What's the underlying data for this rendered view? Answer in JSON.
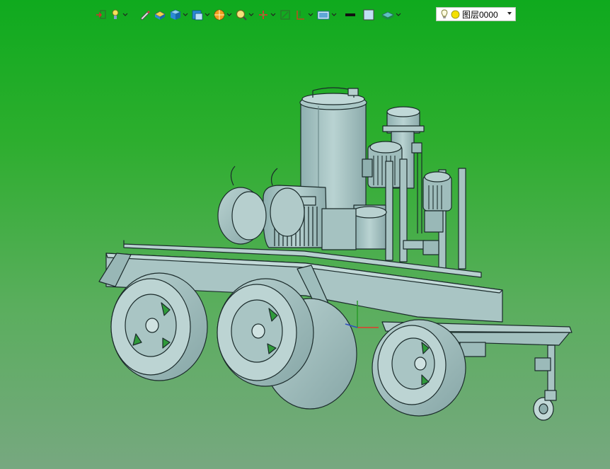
{
  "toolbar": {
    "buttons": [
      {
        "icon": "view-orient-icon",
        "has_menu": true
      },
      {
        "icon": "view-light-icon",
        "has_menu": true
      },
      {
        "icon": "pencil-sketch-icon",
        "has_menu": false
      },
      {
        "icon": "shaded-solid-icon",
        "has_menu": false
      },
      {
        "icon": "cube-view-icon",
        "has_menu": true
      },
      {
        "icon": "display-mode-icon",
        "has_menu": true
      },
      {
        "icon": "render-sphere-icon",
        "has_menu": true
      },
      {
        "icon": "zoom-fit-icon",
        "has_menu": true
      },
      {
        "icon": "cursor-axis-icon",
        "has_menu": true
      },
      {
        "icon": "section-view-icon",
        "has_menu": false
      },
      {
        "icon": "dimension-icon",
        "has_menu": true
      },
      {
        "icon": "camera-view-icon",
        "has_menu": true
      },
      {
        "icon": "line-color-icon",
        "has_menu": false
      },
      {
        "icon": "fill-color-icon",
        "has_menu": false
      },
      {
        "icon": "layer-stack-icon",
        "has_menu": true
      }
    ],
    "accent_color": "#1e8bd4"
  },
  "layer_selector": {
    "selected": "图层0000",
    "bulb_icon": "lightbulb-icon",
    "dot_color": "#f4e000"
  },
  "viewport": {
    "background_top": "#0faa1e",
    "background_bottom": "#77a880",
    "model_color": "#a7c6c5",
    "model_name": "trailer-mounted-oil-filtration-unit"
  }
}
